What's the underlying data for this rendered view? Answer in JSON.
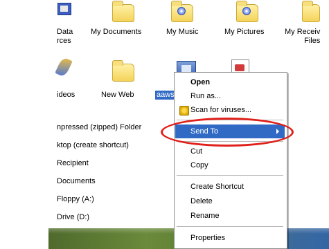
{
  "explorer": {
    "row1_labels": [
      {
        "lines": [
          "Data",
          "rces"
        ]
      },
      {
        "lines": [
          "My Documents"
        ]
      },
      {
        "lines": [
          "My Music"
        ]
      },
      {
        "lines": [
          "My Pictures"
        ]
      },
      {
        "lines": [
          "My Receiv",
          "Files"
        ]
      }
    ],
    "row2_labels": [
      "ideos",
      "New Web",
      "aaws"
    ]
  },
  "send_to_list": [
    "npressed (zipped) Folder",
    "ktop (create shortcut)",
    "Recipient",
    "Documents",
    "Floppy (A:)",
    "Drive (D:)"
  ],
  "context_menu": {
    "open": "Open",
    "run_as": "Run as...",
    "scan": "Scan for viruses...",
    "send_to": "Send To",
    "cut": "Cut",
    "copy": "Copy",
    "create_shortcut": "Create Shortcut",
    "delete": "Delete",
    "rename": "Rename",
    "properties": "Properties"
  },
  "colors": {
    "highlight": "#316ac5",
    "ring": "#e0201a"
  }
}
